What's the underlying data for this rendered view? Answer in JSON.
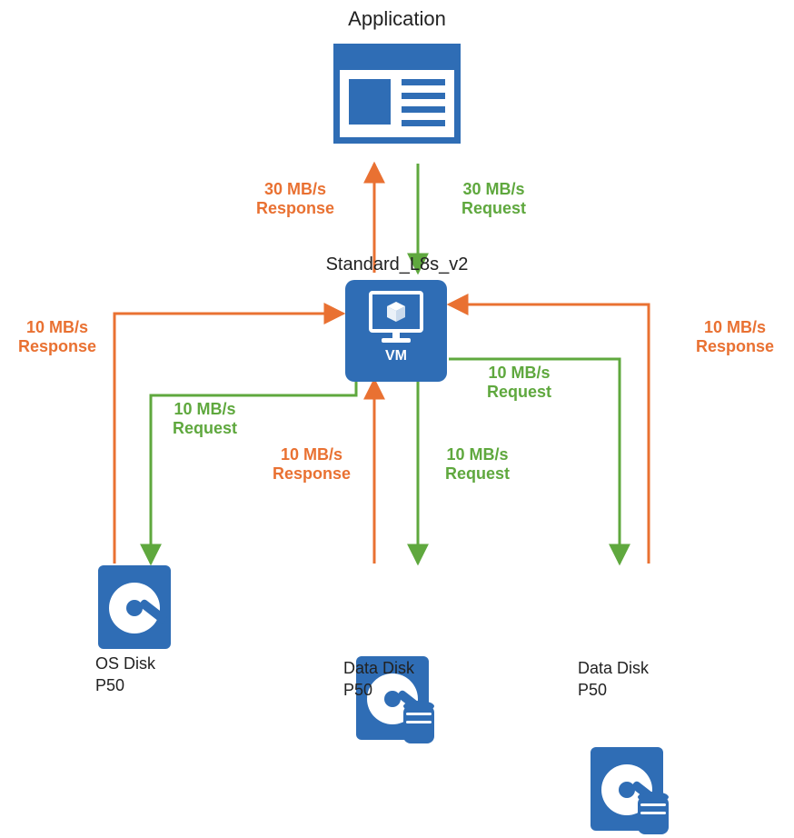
{
  "title": "Application",
  "vm": {
    "sku": "Standard_L8s_v2",
    "caption": "VM"
  },
  "app_vm": {
    "response": "30 MB/s\nResponse",
    "request": "30 MB/s\nRequest"
  },
  "vm_disks": {
    "left": {
      "request": "10 MB/s\nRequest",
      "response": "10 MB/s\nResponse"
    },
    "middle": {
      "request": "10 MB/s\nRequest",
      "response": "10 MB/s\nResponse"
    },
    "right": {
      "request": "10 MB/s\nRequest",
      "response": "10 MB/s\nResponse"
    }
  },
  "disks": {
    "os": {
      "name": "OS Disk",
      "tier": "P50"
    },
    "data1": {
      "name": "Data Disk",
      "tier": "P50"
    },
    "data2": {
      "name": "Data Disk",
      "tier": "P50"
    }
  }
}
